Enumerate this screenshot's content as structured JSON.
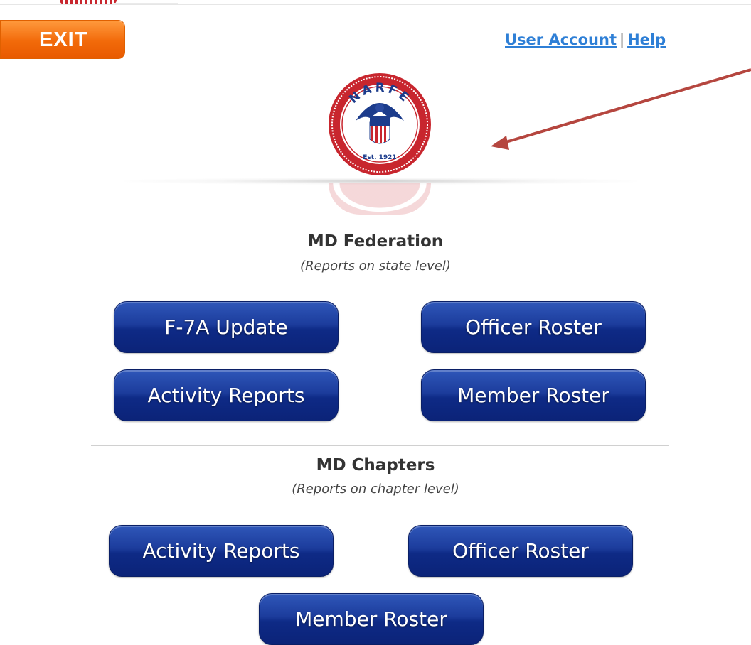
{
  "header": {
    "exit_label": "EXIT",
    "user_account_label": "User Account",
    "separator": "|",
    "help_label": "Help"
  },
  "logo": {
    "name_text": "NARFE",
    "established_text": "Est. 1921",
    "icon": "narfe-eagle-seal-icon"
  },
  "federation": {
    "title": "MD Federation",
    "subtitle": "(Reports on state level)",
    "buttons": {
      "f7a_update": "F-7A Update",
      "officer_roster": "Officer Roster",
      "activity_reports": "Activity Reports",
      "member_roster": "Member Roster"
    }
  },
  "chapters": {
    "title": "MD Chapters",
    "subtitle": "(Reports on chapter level)",
    "buttons": {
      "activity_reports": "Activity Reports",
      "officer_roster": "Officer Roster",
      "member_roster": "Member Roster"
    }
  },
  "colors": {
    "exit_orange": "#f26a0a",
    "button_blue": "#1c3c9c",
    "link_blue": "#2e7fd6",
    "seal_red": "#c8262e",
    "arrow_red": "#b5463f"
  }
}
